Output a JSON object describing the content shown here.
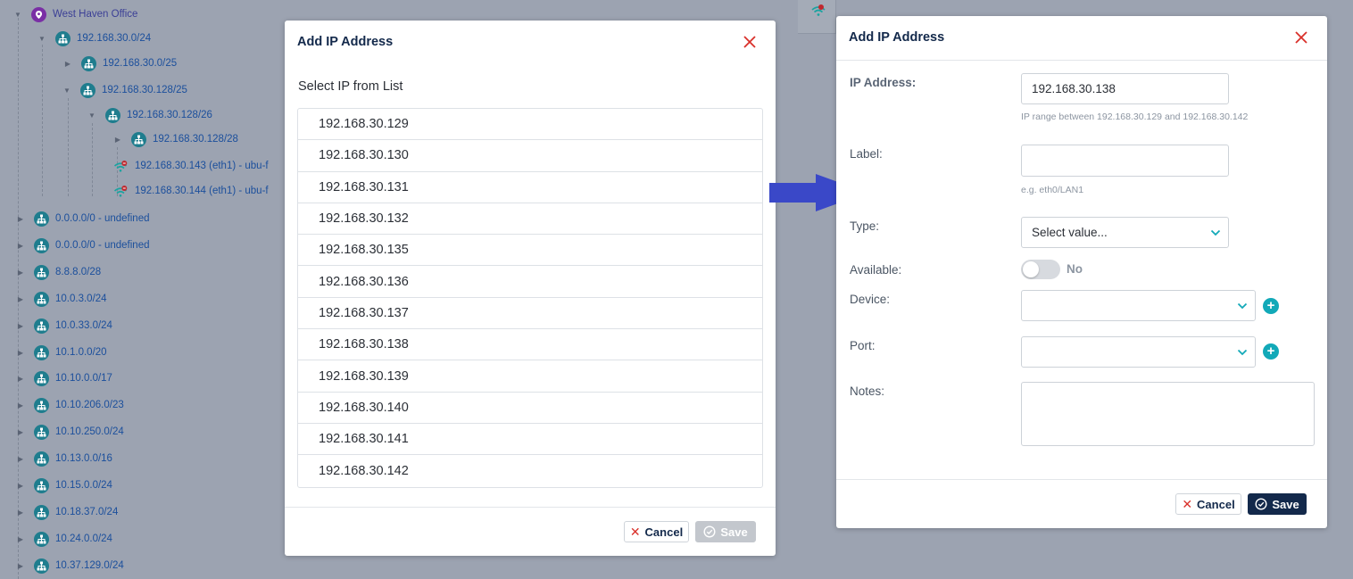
{
  "tree": {
    "nodes": [
      {
        "label": "West Haven Office",
        "kind": "office",
        "caret": "down"
      },
      {
        "label": "192.168.30.0/24",
        "kind": "subnet",
        "caret": "down"
      },
      {
        "label": "192.168.30.0/25",
        "kind": "subnet",
        "caret": "right"
      },
      {
        "label": "192.168.30.128/25",
        "kind": "subnet",
        "caret": "down"
      },
      {
        "label": "192.168.30.128/26",
        "kind": "subnet",
        "caret": "down"
      },
      {
        "label": "192.168.30.128/28",
        "kind": "subnet",
        "caret": "right"
      },
      {
        "label": "192.168.30.143 (eth1) - ubu-f",
        "kind": "device",
        "caret": "none"
      },
      {
        "label": "192.168.30.144 (eth1) - ubu-f",
        "kind": "device",
        "caret": "none"
      },
      {
        "label": "0.0.0.0/0 - undefined",
        "kind": "subnet",
        "caret": "right"
      },
      {
        "label": "0.0.0.0/0 - undefined",
        "kind": "subnet",
        "caret": "right"
      },
      {
        "label": "8.8.8.0/28",
        "kind": "subnet",
        "caret": "right"
      },
      {
        "label": "10.0.3.0/24",
        "kind": "subnet",
        "caret": "right"
      },
      {
        "label": "10.0.33.0/24",
        "kind": "subnet",
        "caret": "right"
      },
      {
        "label": "10.1.0.0/20",
        "kind": "subnet",
        "caret": "right"
      },
      {
        "label": "10.10.0.0/17",
        "kind": "subnet",
        "caret": "right"
      },
      {
        "label": "10.10.206.0/23",
        "kind": "subnet",
        "caret": "right"
      },
      {
        "label": "10.10.250.0/24",
        "kind": "subnet",
        "caret": "right"
      },
      {
        "label": "10.13.0.0/16",
        "kind": "subnet",
        "caret": "right"
      },
      {
        "label": "10.15.0.0/24",
        "kind": "subnet",
        "caret": "right"
      },
      {
        "label": "10.18.37.0/24",
        "kind": "subnet",
        "caret": "right"
      },
      {
        "label": "10.24.0.0/24",
        "kind": "subnet",
        "caret": "right"
      },
      {
        "label": "10.37.129.0/24",
        "kind": "subnet",
        "caret": "right"
      }
    ]
  },
  "list_dialog": {
    "title": "Add IP Address",
    "subtitle": "Select IP from List",
    "ips": [
      "192.168.30.129",
      "192.168.30.130",
      "192.168.30.131",
      "192.168.30.132",
      "192.168.30.135",
      "192.168.30.136",
      "192.168.30.137",
      "192.168.30.138",
      "192.168.30.139",
      "192.168.30.140",
      "192.168.30.141",
      "192.168.30.142"
    ],
    "cancel_label": "Cancel",
    "save_label": "Save",
    "save_disabled": true
  },
  "form_dialog": {
    "title": "Add IP Address",
    "ip_label": "IP Address:",
    "ip_value": "192.168.30.138",
    "ip_hint": "IP range between 192.168.30.129 and 192.168.30.142",
    "label_label": "Label:",
    "label_value": "",
    "label_hint": "e.g. eth0/LAN1",
    "type_label": "Type:",
    "type_placeholder": "Select value...",
    "available_label": "Available:",
    "available_value": "No",
    "device_label": "Device:",
    "port_label": "Port:",
    "notes_label": "Notes:",
    "plus_glyph": "+",
    "cancel_label": "Cancel",
    "save_label": "Save"
  },
  "colors": {
    "backdrop": "#9ca3b1",
    "navy": "#13294b",
    "teal": "#12a9b8",
    "close_red": "#d9302a",
    "arrow_blue": "#3a48c8",
    "link_blue": "#1b4f9c"
  },
  "icons": [
    "caret-down-icon",
    "caret-right-icon",
    "office-icon",
    "network-icon",
    "wifi-alert-icon",
    "close-icon",
    "check-circle-icon",
    "chevron-down-icon",
    "plus-icon",
    "arrow-right-icon"
  ]
}
